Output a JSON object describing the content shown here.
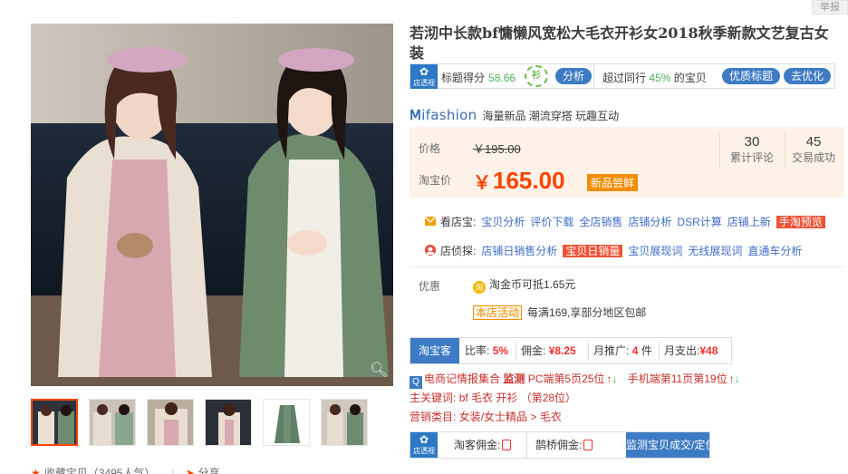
{
  "report_label": "举报",
  "gallery": {
    "zoom_icon": "magnifier-icon",
    "favorites_text": "收藏宝贝（3495人气）",
    "share_text": "分享"
  },
  "product": {
    "title": "若沏中长款bf慵懒风宽松大毛衣开衫女2018秋季新款文艺复古女装"
  },
  "score_bar": {
    "logo_text": "店透视",
    "title_score_label": "标题得分",
    "title_score_value": "58.66",
    "badge_text": "衫",
    "analyze_button": "分析",
    "peer_prefix": "超过同行",
    "peer_pct": "45%",
    "peer_suffix": "的宝贝",
    "quality_title_button": "优质标题",
    "optimize_button": "去优化"
  },
  "brand": {
    "logo_text": "ifashion",
    "slogan": "海量新品 潮流穿搭 玩趣互动"
  },
  "price": {
    "price_label": "价格",
    "original_price": "￥195.00",
    "taobao_price_label": "淘宝价",
    "currency": "￥",
    "sale_price": "165.00",
    "new_tag": "新品尝鲜",
    "reviews_count": "30",
    "reviews_label": "累计评论",
    "sales_count": "45",
    "sales_label": "交易成功"
  },
  "shop_tools": {
    "label": "看店宝:",
    "links": [
      "宝贝分析",
      "评价下载",
      "全店销售",
      "店铺分析",
      "DSR计算",
      "店铺上新"
    ],
    "hot_tag": "手淘预览"
  },
  "shop_spy": {
    "label": "店侦探:",
    "links": [
      "店铺日销售分析"
    ],
    "hot_tag": "宝贝日销量",
    "links_after": [
      "宝贝展现词",
      "无线展现词",
      "直通车分析"
    ]
  },
  "promo": {
    "label": "优惠",
    "coin_text": "淘金币可抵",
    "coin_amount": "1.65元",
    "activity_tag": "本店活动",
    "activity_text": "每满169,享部分地区包邮"
  },
  "commission": {
    "head": "淘宝客",
    "rate_label": "比率:",
    "rate_value": "5%",
    "commission_label": "佣金:",
    "commission_value": "¥8.25",
    "monthly_promo_label": "月推广:",
    "monthly_promo_value": "4",
    "monthly_promo_unit": "件",
    "monthly_spend_label": "月支出:",
    "monthly_spend_value": "¥48"
  },
  "rank_line": {
    "q_icon": "Q",
    "text": "电商记情报集合",
    "monitor": "监测",
    "pc_rank": "PC端第5页25位",
    "mobile_rank": "手机端第11页第19位"
  },
  "keywords": {
    "label": "主关键词:",
    "value": "bf 毛衣 开衫 （第28位）"
  },
  "category": {
    "label": "营销类目:",
    "value": "女装/女士精品 > 毛衣"
  },
  "bottom_bar": {
    "logo_text": "店透视",
    "taoke_label": "淘客佣金:",
    "queqiao_label": "鹊桥佣金:",
    "button": "监测宝贝成交/定位"
  },
  "colors": {
    "accent_orange": "#ff4400",
    "link_blue": "#3d6ec7",
    "button_blue": "#3d7bc4",
    "score_green": "#4bb45b"
  }
}
